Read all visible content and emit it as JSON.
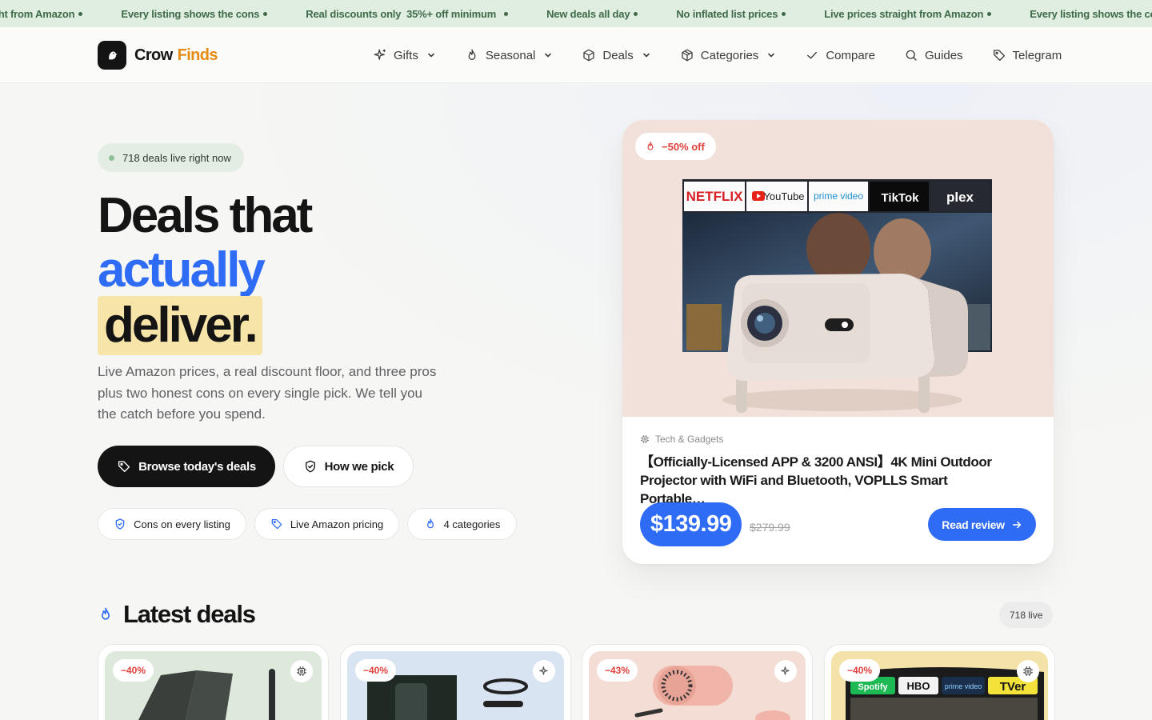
{
  "ticker": {
    "items": [
      "ght from Amazon",
      "Every listing shows the cons",
      "Real discounts only  35%+ off minimum",
      "New deals all day",
      "No inflated list prices",
      "Live prices straight from Amazon",
      "Every listing shows the cons"
    ]
  },
  "brand": {
    "name": "Crow",
    "accent": "Finds"
  },
  "nav": {
    "items": [
      {
        "label": "Gifts",
        "icon": "sparkle-icon",
        "dropdown": true
      },
      {
        "label": "Seasonal",
        "icon": "flame-icon",
        "dropdown": true
      },
      {
        "label": "Deals",
        "icon": "box-icon",
        "dropdown": true
      },
      {
        "label": "Categories",
        "icon": "box-icon",
        "dropdown": true
      },
      {
        "label": "Compare",
        "icon": "check-icon",
        "dropdown": false
      },
      {
        "label": "Guides",
        "icon": "search-icon",
        "dropdown": false
      },
      {
        "label": "Telegram",
        "icon": "tag-icon",
        "dropdown": false
      }
    ]
  },
  "hero": {
    "live_pill": "718 deals live right now",
    "headline": {
      "line1": "Deals that",
      "line2": "actually",
      "line3": "deliver."
    },
    "subcopy": "Live Amazon prices, a real discount floor, and three pros plus two honest cons on every single pick. We tell you the catch before you spend.",
    "primary_button": "Browse today's deals",
    "secondary_button": "How we pick",
    "features": [
      "Cons on every listing",
      "Live Amazon pricing",
      "4 categories"
    ]
  },
  "featured": {
    "badge": "−50% off",
    "category": "Tech & Gadgets",
    "title": "【Officially-Licensed APP & 3200 ANSI】4K Mini Outdoor Projector with WiFi and Bluetooth, VOPLLS Smart Portable…",
    "price": "$139.99",
    "old_price": "$279.99",
    "cta": "Read review",
    "screen_brands": [
      "NETFLIX",
      "YouTube",
      "prime video",
      "TikTok",
      "plex"
    ]
  },
  "latest": {
    "title": "Latest deals",
    "live_count": "718 live",
    "cards": [
      {
        "badge": "−40%",
        "icon": "chip-icon",
        "bg": "#dde9da"
      },
      {
        "badge": "−40%",
        "icon": "sparkle-icon",
        "bg": "#d9e4f3"
      },
      {
        "badge": "−43%",
        "icon": "sparkle-icon",
        "bg": "#f3ddd5"
      },
      {
        "badge": "−40%",
        "icon": "chip-icon",
        "bg": "#f4e3a8",
        "brands": [
          "Spotify",
          "HBO",
          "prime video",
          "TVer"
        ]
      }
    ]
  },
  "colors": {
    "accent_blue": "#2f6cf5",
    "brand_orange": "#e58a12",
    "ticker_bg": "#dfeee0",
    "highlight": "#f7e4a8",
    "badge_red": "#e0413c"
  }
}
